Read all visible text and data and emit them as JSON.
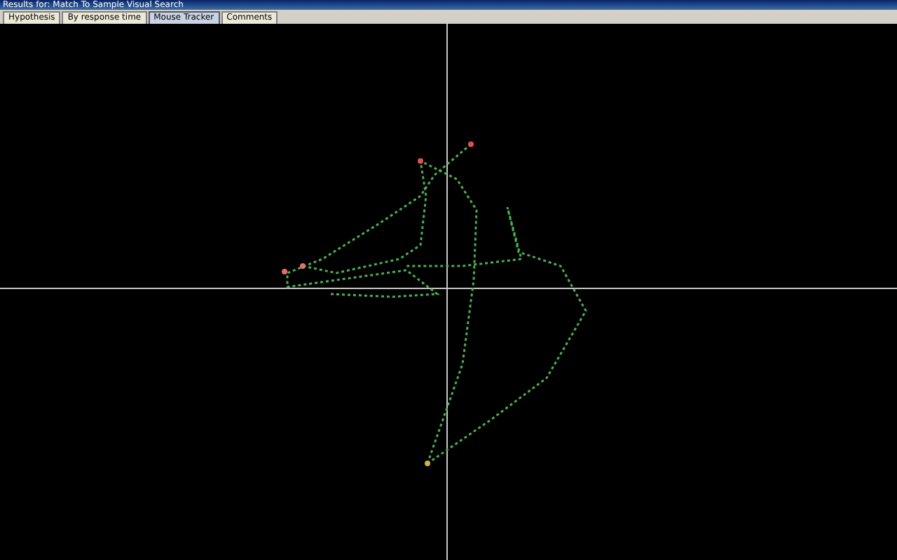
{
  "window": {
    "title": "Results for: Match To Sample Visual Search"
  },
  "tabs": [
    {
      "label": "Hypothesis",
      "selected": false
    },
    {
      "label": "By response time",
      "selected": false
    },
    {
      "label": "Mouse Tracker",
      "selected": true
    },
    {
      "label": "Comments",
      "selected": false
    }
  ]
}
